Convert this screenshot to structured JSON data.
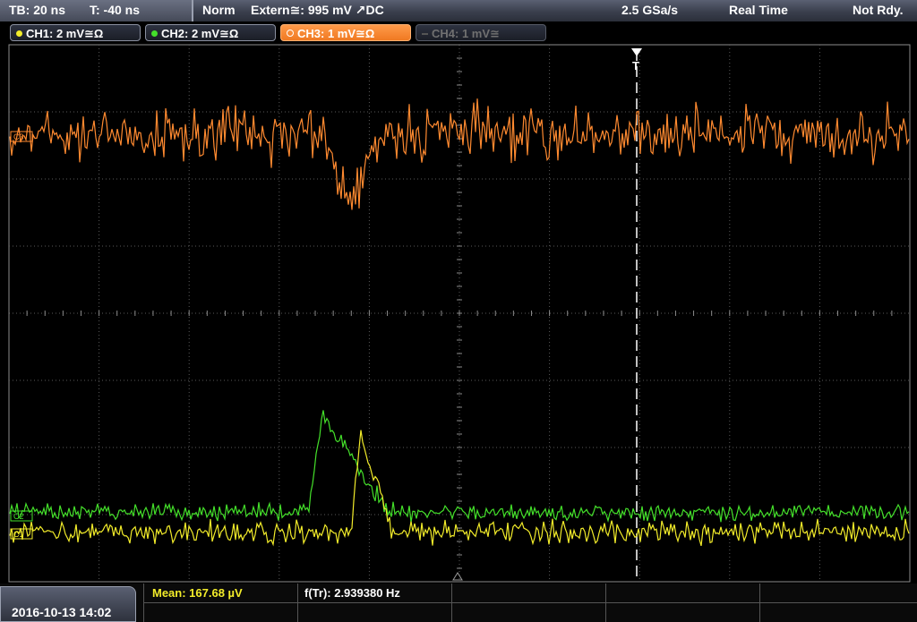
{
  "topbar": {
    "timebase": "TB: 20 ns",
    "trigger_time": "T: -40 ns",
    "trigger_mode": "Norm",
    "trigger_source": "Extern≅: 995 mV ↗DC",
    "sample_rate": "2.5 GSa/s",
    "acq_mode": "Real Time",
    "status": "Not Rdy."
  },
  "channels": [
    {
      "label": "CH1: 2 mV≅Ω",
      "color": "#f2ec2a",
      "state": "on"
    },
    {
      "label": "CH2: 2 mV≅Ω",
      "color": "#44e02a",
      "state": "on"
    },
    {
      "label": "CH3: 1 mV≅Ω",
      "color": "#ff8a30",
      "state": "active"
    },
    {
      "label": "CH4: 1 mV≅",
      "color": "#6a6a6a",
      "state": "off"
    }
  ],
  "markers": {
    "trigger": "T",
    "ch3_ref": "C3",
    "ch2_ref": "C2",
    "ch1_ref": "C1"
  },
  "bottom": {
    "datetime": "2016-10-13 14:02",
    "mean": "Mean: 167.68 µV",
    "freq": "f(Tr): 2.939380 Hz"
  },
  "colors": {
    "ch1": "#f2ec2a",
    "ch2": "#44e02a",
    "ch3": "#ff8a30",
    "grid": "#6a6a6a"
  }
}
